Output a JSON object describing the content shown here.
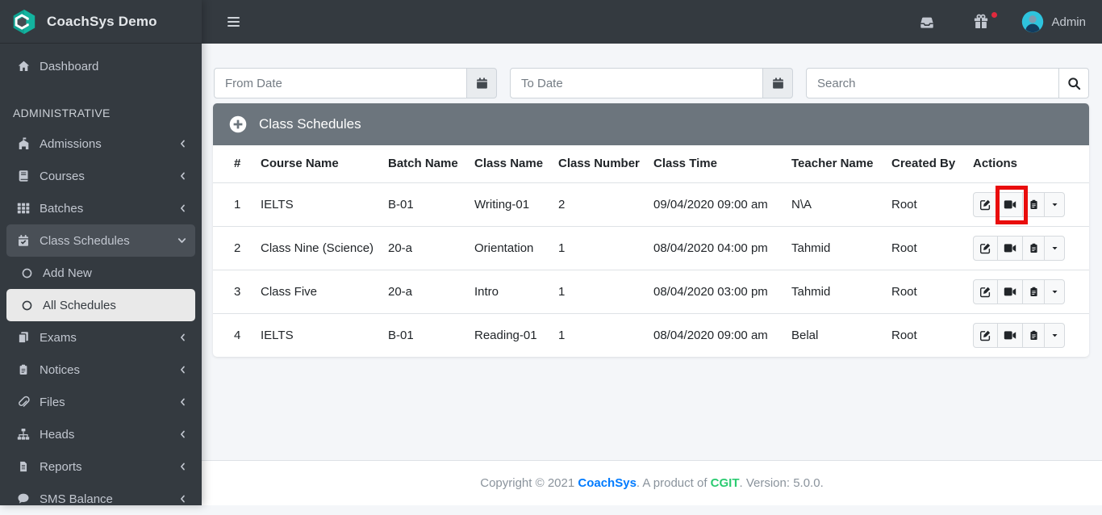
{
  "brand": {
    "name": "CoachSys Demo"
  },
  "topbar": {
    "user_label": "Admin"
  },
  "sidebar": {
    "items": [
      {
        "id": "dashboard",
        "label": "Dashboard",
        "icon": "home"
      },
      {
        "type": "header",
        "label": "ADMINISTRATIVE"
      },
      {
        "id": "admissions",
        "label": "Admissions",
        "icon": "school",
        "chevron": "left"
      },
      {
        "id": "courses",
        "label": "Courses",
        "icon": "book",
        "chevron": "left"
      },
      {
        "id": "batches",
        "label": "Batches",
        "icon": "grid",
        "chevron": "left"
      },
      {
        "id": "class-schedules",
        "label": "Class Schedules",
        "icon": "calendar-check",
        "chevron": "down",
        "state": "open"
      },
      {
        "id": "add-new",
        "label": "Add New",
        "icon": "circle",
        "type": "subitem"
      },
      {
        "id": "all-schedules",
        "label": "All Schedules",
        "icon": "circle",
        "type": "subitem",
        "state": "active"
      },
      {
        "id": "exams",
        "label": "Exams",
        "icon": "copy",
        "chevron": "left"
      },
      {
        "id": "notices",
        "label": "Notices",
        "icon": "clipboard",
        "chevron": "left"
      },
      {
        "id": "files",
        "label": "Files",
        "icon": "paperclip",
        "chevron": "left"
      },
      {
        "id": "heads",
        "label": "Heads",
        "icon": "sitemap",
        "chevron": "left"
      },
      {
        "id": "reports",
        "label": "Reports",
        "icon": "file-lines",
        "chevron": "left"
      },
      {
        "id": "sms-balance",
        "label": "SMS Balance",
        "icon": "comment",
        "chevron": "left"
      }
    ]
  },
  "filters": {
    "from_date_placeholder": "From Date",
    "to_date_placeholder": "To Date",
    "search_placeholder": "Search"
  },
  "panel": {
    "title": "Class Schedules"
  },
  "table": {
    "columns": [
      "#",
      "Course Name",
      "Batch Name",
      "Class Name",
      "Class Number",
      "Class Time",
      "Teacher Name",
      "Created By",
      "Actions"
    ],
    "action_buttons": [
      "edit",
      "video",
      "paste",
      "caret-down"
    ],
    "rows": [
      {
        "num": "1",
        "course": "IELTS",
        "batch": "B-01",
        "class_name": "Writing-01",
        "class_number": "2",
        "class_time": "09/04/2020 09:00 am",
        "teacher": "N\\A",
        "created_by": "Root"
      },
      {
        "num": "2",
        "course": "Class Nine (Science)",
        "batch": "20-a",
        "class_name": "Orientation",
        "class_number": "1",
        "class_time": "08/04/2020 04:00 pm",
        "teacher": "Tahmid",
        "created_by": "Root"
      },
      {
        "num": "3",
        "course": "Class Five",
        "batch": "20-a",
        "class_name": "Intro",
        "class_number": "1",
        "class_time": "08/04/2020 03:00 pm",
        "teacher": "Tahmid",
        "created_by": "Root"
      },
      {
        "num": "4",
        "course": "IELTS",
        "batch": "B-01",
        "class_name": "Reading-01",
        "class_number": "1",
        "class_time": "08/04/2020 09:00 am",
        "teacher": "Belal",
        "created_by": "Root"
      }
    ]
  },
  "annotation": {
    "target": "row-1-video-button",
    "color": "#e90d0d"
  },
  "footer": {
    "prefix": "Copyright © 2021 ",
    "brand": "CoachSys",
    "middle": ". A product of ",
    "company": "CGIT",
    "suffix": ". Version: 5.0.0."
  },
  "colors": {
    "sidebar_dark": "#343a40",
    "brand_teal": "#13b39f",
    "panel_header_gray": "#6c757d",
    "annotation_red": "#e90d0d",
    "footer_link_blue": "#007bff",
    "footer_link_green": "#2bcb71",
    "notification_dot_red": "#e0293d",
    "avatar_cyan": "#2ec3dd"
  }
}
